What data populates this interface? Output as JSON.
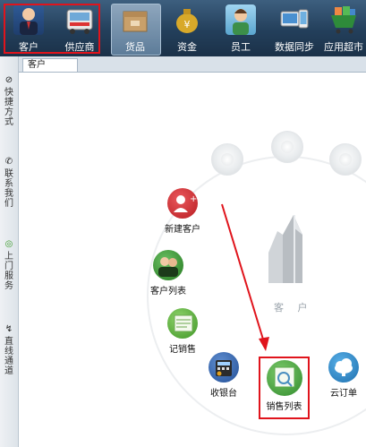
{
  "toolbar": {
    "items": [
      {
        "label": "客户",
        "icon": "customer-person-icon"
      },
      {
        "label": "供应商",
        "icon": "supplier-truck-icon"
      },
      {
        "label": "货品",
        "icon": "goods-box-icon"
      },
      {
        "label": "资金",
        "icon": "money-bag-icon"
      },
      {
        "label": "员工",
        "icon": "employee-icon"
      },
      {
        "label": "数据同步",
        "icon": "data-sync-icon"
      },
      {
        "label": "应用超市",
        "icon": "app-market-cart-icon"
      }
    ],
    "active": "货品",
    "highlight_color": "#e0141c"
  },
  "sidebar": {
    "items": [
      {
        "label": "快捷方式",
        "icon": "shortcut-icon"
      },
      {
        "label": "联系我们",
        "icon": "phone-icon"
      },
      {
        "label": "上门服务",
        "icon": "bicycle-icon"
      },
      {
        "label": "直线通道",
        "icon": "zigzag-icon"
      }
    ]
  },
  "tab": {
    "label": "客户"
  },
  "main": {
    "center_label": "客 户",
    "functions": [
      {
        "label": "新建客户",
        "icon": "add-customer-icon",
        "color": "#c8262b"
      },
      {
        "label": "客户列表",
        "icon": "customer-list-icon",
        "color": "#2f8a2b"
      },
      {
        "label": "记销售",
        "icon": "record-sale-icon",
        "color": "#4aa22e"
      },
      {
        "label": "收银台",
        "icon": "cash-register-icon",
        "color": "#2f5ea8"
      },
      {
        "label": "销售列表",
        "icon": "sales-list-icon",
        "color": "#3d9c3a"
      },
      {
        "label": "云订单",
        "icon": "cloud-order-icon",
        "color": "#2f86c6"
      }
    ],
    "annotation_color": "#e0141c"
  }
}
